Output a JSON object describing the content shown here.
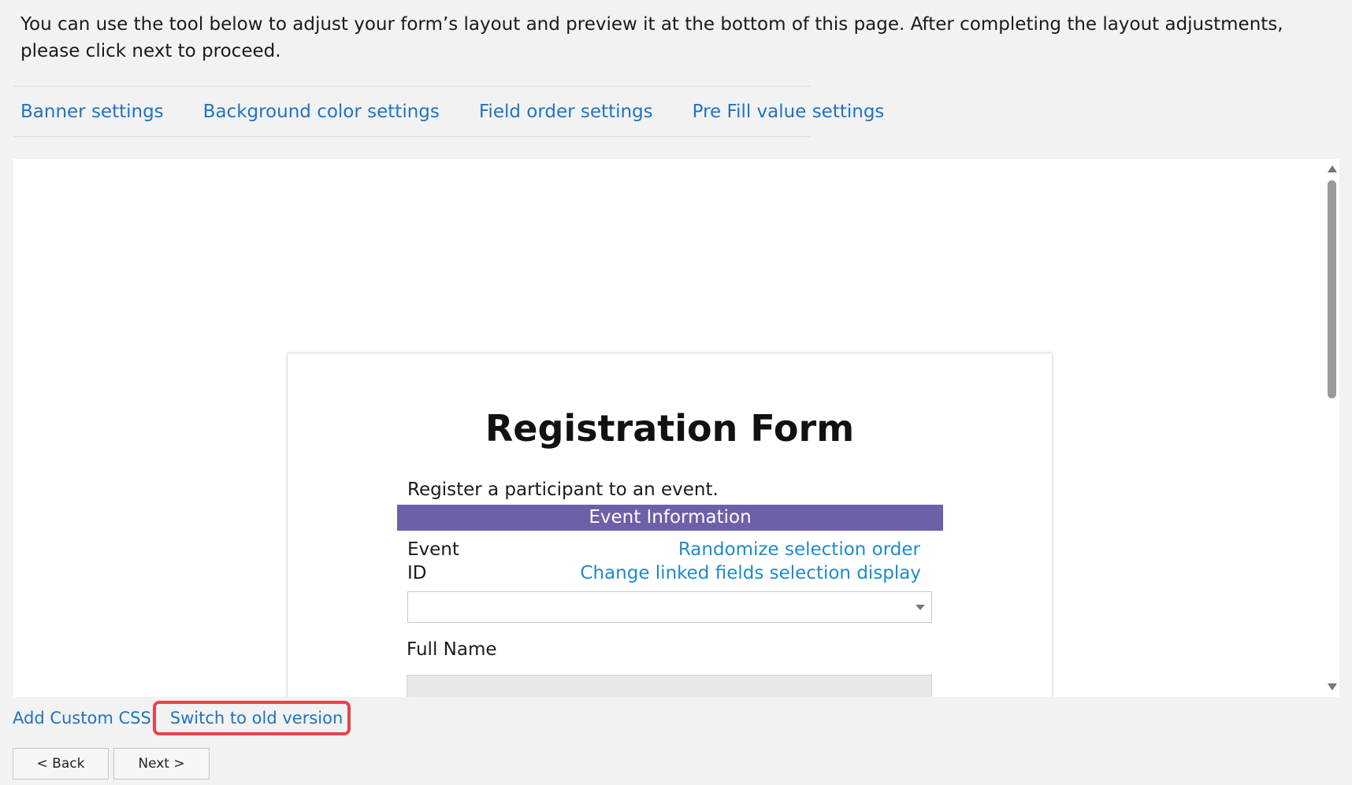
{
  "intro": {
    "text": "You can use the tool below to adjust your form’s layout and preview it at the bottom of this page. After completing the layout adjustments, please click next to proceed."
  },
  "tabs": [
    {
      "label": "Banner settings"
    },
    {
      "label": "Background color settings"
    },
    {
      "label": "Field order settings"
    },
    {
      "label": "Pre Fill value settings"
    }
  ],
  "preview": {
    "form": {
      "title": "Registration Form",
      "description": "Register a participant to an event.",
      "section_title": "Event Information",
      "section_color": "#6e5fa8",
      "event_label": "Event",
      "id_label": "ID",
      "randomize_link": "Randomize selection order",
      "linked_display_link": "Change linked fields selection display",
      "full_name_label": "Full Name"
    }
  },
  "links": {
    "custom_css": "Add Custom CSS",
    "switch_version": "Switch to old version"
  },
  "buttons": {
    "back": "< Back",
    "next": "Next >"
  },
  "colors": {
    "link": "#1f74c0",
    "highlight": "#e8434a"
  }
}
